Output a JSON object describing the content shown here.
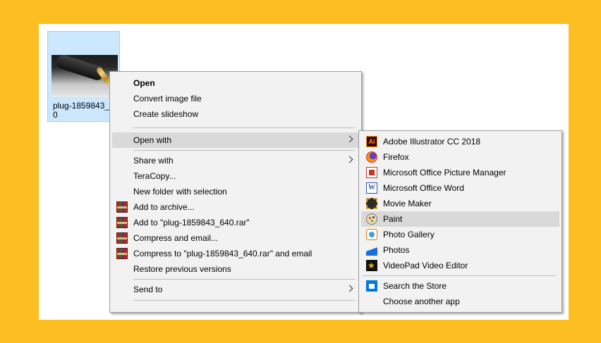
{
  "file": {
    "name": "plug-1859843_640",
    "thumbnail_icon": "image-thumbnail-icon"
  },
  "context_menu": {
    "items": [
      {
        "label": "Open",
        "bold": true
      },
      {
        "label": "Convert image file"
      },
      {
        "label": "Create slideshow"
      },
      {
        "label": "Open with",
        "has_submenu": true,
        "highlighted": true
      },
      {
        "label": "Share with",
        "has_submenu": true
      },
      {
        "label": "TeraCopy..."
      },
      {
        "label": "New folder with selection"
      },
      {
        "label": "Add to archive...",
        "icon": "winrar-icon"
      },
      {
        "label": "Add to \"plug-1859843_640.rar\"",
        "icon": "winrar-icon"
      },
      {
        "label": "Compress and email...",
        "icon": "winrar-icon"
      },
      {
        "label": "Compress to \"plug-1859843_640.rar\" and email",
        "icon": "winrar-icon"
      },
      {
        "label": "Restore previous versions"
      },
      {
        "label": "Send to",
        "has_submenu": true
      }
    ]
  },
  "open_with_menu": {
    "items": [
      {
        "label": "Adobe Illustrator CC 2018",
        "icon": "illustrator-icon",
        "icon_text": "Ai"
      },
      {
        "label": "Firefox",
        "icon": "firefox-icon"
      },
      {
        "label": "Microsoft Office Picture Manager",
        "icon": "picture-manager-icon"
      },
      {
        "label": "Microsoft Office Word",
        "icon": "word-icon",
        "icon_text": "W"
      },
      {
        "label": "Movie Maker",
        "icon": "movie-maker-icon"
      },
      {
        "label": "Paint",
        "icon": "paint-icon",
        "highlighted": true
      },
      {
        "label": "Photo Gallery",
        "icon": "photo-gallery-icon"
      },
      {
        "label": "Photos",
        "icon": "photos-icon"
      },
      {
        "label": "VideoPad Video Editor",
        "icon": "videopad-icon"
      },
      {
        "label": "Search the Store",
        "icon": "store-icon"
      },
      {
        "label": "Choose another app"
      }
    ]
  },
  "colors": {
    "background": "#FDBE22",
    "menu_background": "#F2F2F2",
    "menu_highlight": "#D9D9D9",
    "selection": "#CCE8FF"
  }
}
